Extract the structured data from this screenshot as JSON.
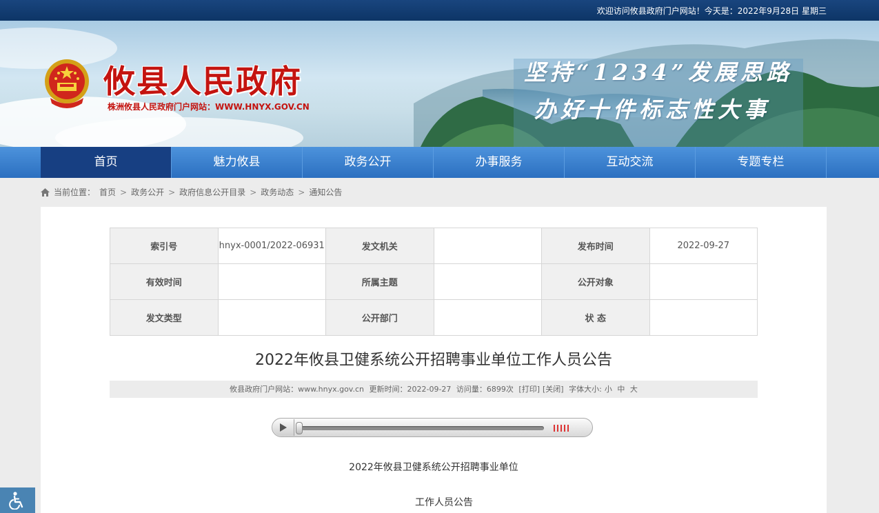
{
  "topbar": {
    "welcome": "欢迎访问攸县政府门户网站！今天是：2022年9月28日 星期三"
  },
  "header": {
    "site_title": "攸县人民政府",
    "site_subtitle": "株洲攸县人民政府门户网站：WWW.HNYX.GOV.CN",
    "slogan_line1": "坚持“1234”发展思路",
    "slogan_line2": "办好十件标志性大事"
  },
  "nav": {
    "items": [
      {
        "label": "首页",
        "active": true
      },
      {
        "label": "魅力攸县"
      },
      {
        "label": "政务公开"
      },
      {
        "label": "办事服务"
      },
      {
        "label": "互动交流"
      },
      {
        "label": "专题专栏"
      }
    ]
  },
  "breadcrumb": {
    "prefix": "当前位置：",
    "items": [
      "首页",
      "政务公开",
      "政府信息公开目录",
      "政务动态",
      "通知公告"
    ],
    "separator": ">"
  },
  "info_table": {
    "rows": [
      [
        {
          "k": "索引号"
        },
        {
          "v": "hnyx-0001/2022-06931"
        },
        {
          "k": "发文机关"
        },
        {
          "v": ""
        },
        {
          "k": "发布时间"
        },
        {
          "v": "2022-09-27"
        }
      ],
      [
        {
          "k": "有效时间"
        },
        {
          "v": ""
        },
        {
          "k": "所属主题"
        },
        {
          "v": ""
        },
        {
          "k": "公开对象"
        },
        {
          "v": ""
        }
      ],
      [
        {
          "k": "发文类型"
        },
        {
          "v": ""
        },
        {
          "k": "公开部门"
        },
        {
          "v": ""
        },
        {
          "k": "状  态"
        },
        {
          "v": ""
        }
      ]
    ]
  },
  "article": {
    "title": "2022年攸县卫健系统公开招聘事业单位工作人员公告",
    "meta": {
      "source": "攸县政府门户网站：www.hnyx.gov.cn",
      "updated": "更新时间：2022-09-27",
      "views": "访问量：6899次",
      "print": "[打印]",
      "close": "[关闭]",
      "font_label": "字体大小:",
      "font_small": "小",
      "font_medium": "中",
      "font_large": "大"
    },
    "paragraph1": "2022年攸县卫健系统公开招聘事业单位",
    "paragraph2": "工作人员公告"
  },
  "colors": {
    "topbar": "#0d3566",
    "nav": "#3a82d0",
    "nav_active": "#173f82",
    "title_red": "#c41410",
    "accessibility": "#4a84b3"
  },
  "icons": {
    "home": "home-icon",
    "play": "play-icon",
    "volume": "volume-icon",
    "accessibility": "wheelchair-icon",
    "emblem": "national-emblem"
  }
}
